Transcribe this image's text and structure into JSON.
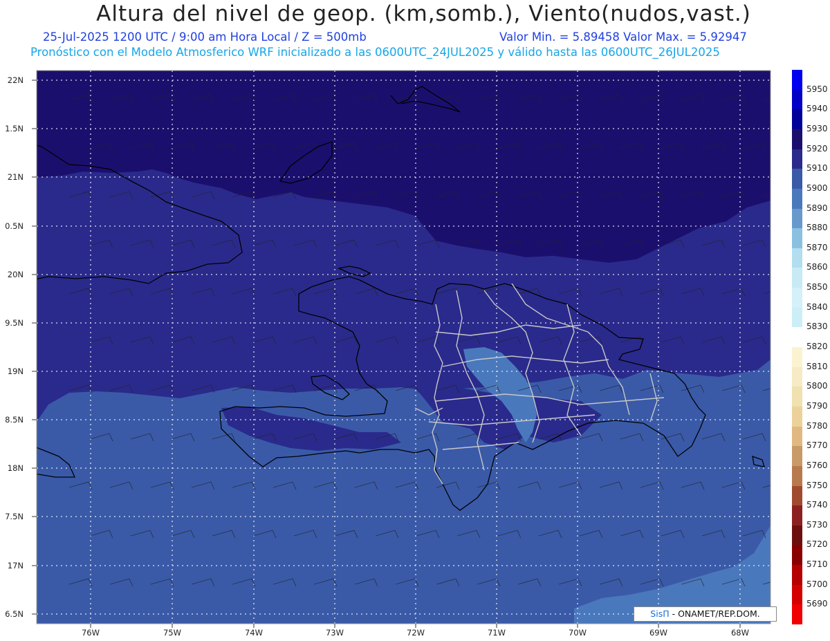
{
  "header": {
    "title": "Altura del nivel de geop. (km,somb.), Viento(nudos,vast.)",
    "subtitle_left": "25-Jul-2025   1200 UTC / 9:00 am Hora Local / Z = 500mb",
    "subtitle_right": "Valor Min. = 5.89458  Valor Max. = 5.92947",
    "model_line": "Pronóstico con el Modelo Atmosferico WRF inicializado a las 0600UTC_24JUL2025 y válido hasta las  0600UTC_26JUL2025"
  },
  "axes": {
    "lat_labels": [
      "22N",
      "1.5N",
      "21N",
      "0.5N",
      "20N",
      "9.5N",
      "19N",
      "8.5N",
      "18N",
      "7.5N",
      "17N",
      "6.5N"
    ],
    "lon_labels": [
      "76W",
      "75W",
      "74W",
      "73W",
      "72W",
      "71W",
      "70W",
      "69W",
      "68W"
    ]
  },
  "colorbar": {
    "levels": [
      "5950",
      "5940",
      "5930",
      "5920",
      "5910",
      "5900",
      "5890",
      "5880",
      "5870",
      "5860",
      "5850",
      "5840",
      "5830",
      "5820",
      "5810",
      "5800",
      "5790",
      "5780",
      "5770",
      "5760",
      "5750",
      "5740",
      "5730",
      "5720",
      "5710",
      "5700",
      "5690"
    ],
    "colors": [
      "#0000f0",
      "#0000c8",
      "#00009a",
      "#1b0f6e",
      "#2a2a8c",
      "#3a5aa8",
      "#4a78bc",
      "#6898cc",
      "#8cc0e0",
      "#b2def0",
      "#c8eaf4",
      "#d4f0f8",
      "#cceef6",
      "#ffffff",
      "#fbf3d0",
      "#f6ebc4",
      "#f1e0b0",
      "#ecd29a",
      "#e0b880",
      "#c89a68",
      "#b87a4c",
      "#a04a30",
      "#8c2020",
      "#6e0f0f",
      "#8a0000",
      "#b40000",
      "#d40000",
      "#f00000"
    ]
  },
  "credit": {
    "brand": "SisΠ",
    "org": " - ONAMET/REP.DOM."
  },
  "palette": {
    "z5920": "#1b0f6e",
    "z5910": "#2a2a8c",
    "z5900": "#3a5aa8",
    "z5890": "#4a78bc",
    "coast": "#000000",
    "borders": "#c8c8c8"
  }
}
